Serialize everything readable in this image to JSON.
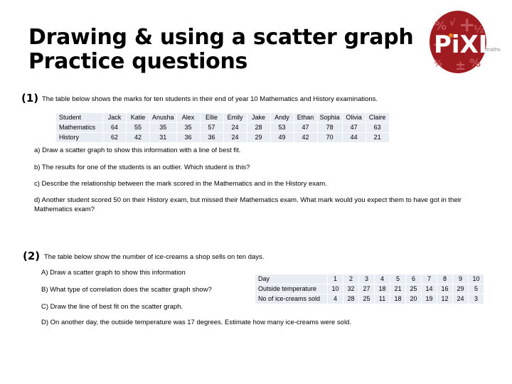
{
  "title": {
    "line1": "Drawing & using a scatter graph",
    "line2": "Practice questions"
  },
  "logo": {
    "name": "pixl-maths-logo",
    "wordmark": "PiXL",
    "subtext": "maths",
    "brand_color": "#9e1b20",
    "accent_color": "#f07d1a",
    "symbols": [
      "%",
      "√",
      "+",
      "½",
      "÷",
      "·",
      "¾",
      "±",
      "%"
    ]
  },
  "question1": {
    "number": "(1)",
    "intro": "The table below shows the marks for ten students in their end of year 10 Mathematics and History examinations.",
    "table": {
      "rows": [
        [
          "Student",
          "Jack",
          "Katie",
          "Anusha",
          "Alex",
          "Ellie",
          "Emily",
          "Jake",
          "Andy",
          "Ethan",
          "Sophia",
          "Olivia",
          "Claire"
        ],
        [
          "Mathematics",
          "64",
          "55",
          "35",
          "35",
          "57",
          "24",
          "28",
          "53",
          "47",
          "78",
          "47",
          "63"
        ],
        [
          "History",
          "62",
          "42",
          "31",
          "36",
          "36",
          "24",
          "29",
          "49",
          "42",
          "70",
          "44",
          "21"
        ]
      ]
    },
    "parts": [
      "a) Draw a scatter graph to show this information with a line of best fit.",
      "b) The results for one of the students is an outlier.  Which student is this?",
      "c) Describe the relationship between the mark scored in the Mathematics and in the History exam.",
      "d) Another student scored 50 on their History exam, but missed their Mathematics exam.  What mark would you expect them to have got in their Mathematics exam?"
    ]
  },
  "question2": {
    "number": "(2)",
    "intro": "The table below show the number of ice-creams a shop sells on ten days.",
    "parts": [
      "A) Draw a scatter graph to show this information",
      "B) What type of correlation does the scatter graph show?",
      "C) Draw the line of best fit on the scatter graph.",
      "D) On another day, the outside temperature was 17 degrees. Estimate how many ice-creams were sold."
    ],
    "table": {
      "rows": [
        [
          "Day",
          "1",
          "2",
          "3",
          "4",
          "5",
          "6",
          "7",
          "8",
          "9",
          "10"
        ],
        [
          "Outside temperature",
          "10",
          "32",
          "27",
          "18",
          "21",
          "25",
          "14",
          "16",
          "29",
          "5"
        ],
        [
          "No of ice-creams sold",
          "4",
          "28",
          "25",
          "11",
          "18",
          "20",
          "19",
          "12",
          "24",
          "3"
        ]
      ]
    }
  }
}
